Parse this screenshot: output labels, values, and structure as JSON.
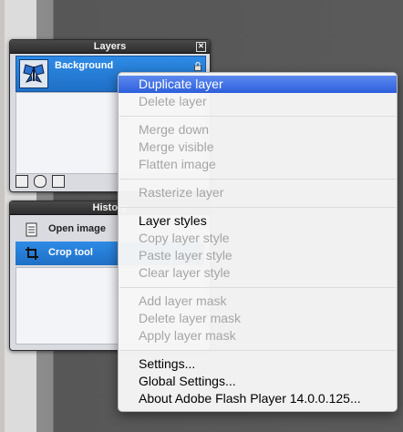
{
  "layers_panel": {
    "title": "Layers",
    "close_label": "✕",
    "layer_name": "Background"
  },
  "history_panel": {
    "title": "History",
    "items": [
      {
        "label": "Open image",
        "selected": false,
        "icon": "open-image-icon"
      },
      {
        "label": "Crop tool",
        "selected": true,
        "icon": "crop-icon"
      }
    ]
  },
  "context_menu": {
    "items": [
      {
        "label": "Duplicate layer",
        "disabled": false,
        "highlighted": true
      },
      {
        "label": "Delete layer",
        "disabled": true
      },
      {
        "label": "Merge down",
        "disabled": true
      },
      {
        "label": "Merge visible",
        "disabled": true
      },
      {
        "label": "Flatten image",
        "disabled": true
      },
      {
        "label": "Rasterize layer",
        "disabled": true
      },
      {
        "label": "Layer styles",
        "disabled": false
      },
      {
        "label": "Copy layer style",
        "disabled": true
      },
      {
        "label": "Paste layer style",
        "disabled": true
      },
      {
        "label": "Clear layer style",
        "disabled": true
      },
      {
        "label": "Add layer mask",
        "disabled": true
      },
      {
        "label": "Delete layer mask",
        "disabled": true
      },
      {
        "label": "Apply layer mask",
        "disabled": true
      },
      {
        "label": "Settings...",
        "disabled": false
      },
      {
        "label": "Global Settings...",
        "disabled": false
      },
      {
        "label": "About Adobe Flash Player 14.0.0.125...",
        "disabled": false
      }
    ]
  },
  "colors": {
    "highlight": "#3b6fe3",
    "selection_blue": "#2a7fda",
    "disabled_text": "#a5a5a5"
  }
}
